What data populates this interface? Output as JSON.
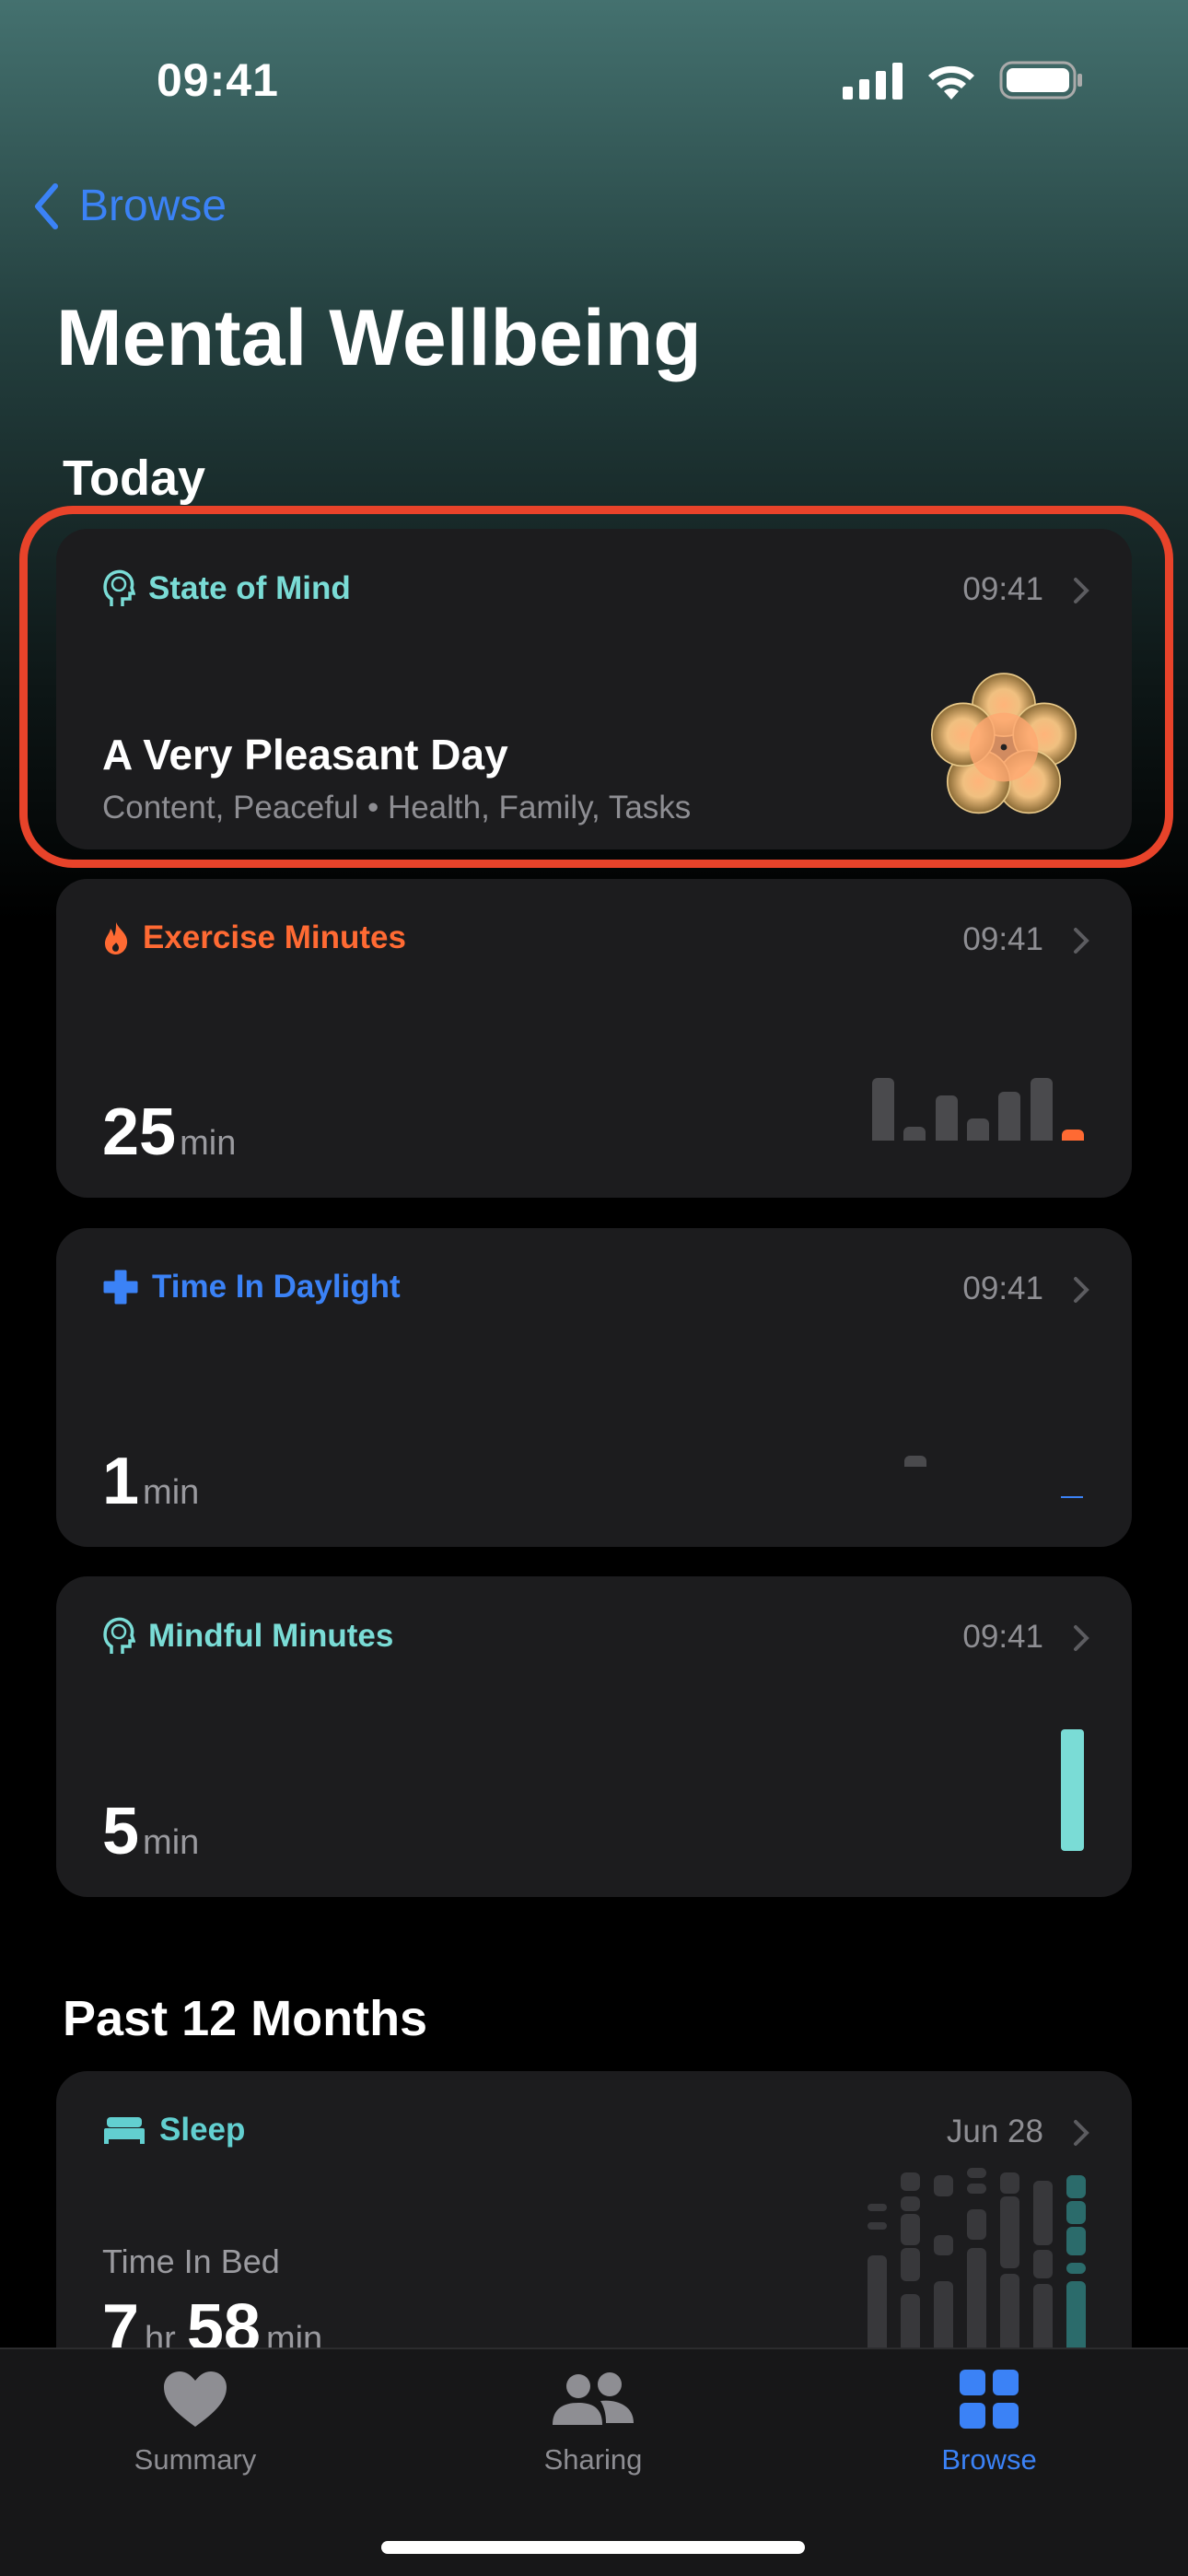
{
  "status_bar": {
    "time": "09:41",
    "icons": [
      "cellular-signal-icon",
      "wifi-icon",
      "battery-icon"
    ]
  },
  "nav": {
    "back_label": "Browse"
  },
  "page_title": "Mental Wellbeing",
  "sections": {
    "today": "Today",
    "past": "Past 12 Months"
  },
  "colors": {
    "state_of_mind": "#7adcd6",
    "exercise": "#ff6a33",
    "daylight": "#3b82f6",
    "mindful": "#7adcd6",
    "sleep": "#62cfd0",
    "highlight": "#e8432a"
  },
  "cards": {
    "state_of_mind": {
      "label": "State of Mind",
      "time": "09:41",
      "headline": "A Very Pleasant Day",
      "details": "Content, Peaceful • Health, Family, Tasks",
      "icon": "head-brain-icon"
    },
    "exercise": {
      "label": "Exercise Minutes",
      "time": "09:41",
      "value": "25",
      "unit": "min",
      "icon": "flame-icon",
      "bars": [
        140,
        30,
        100,
        50,
        110,
        140,
        25
      ]
    },
    "daylight": {
      "label": "Time In Daylight",
      "time": "09:41",
      "value": "1",
      "unit": "min",
      "icon": "plus-icon",
      "bars": [
        0,
        12,
        0,
        0,
        0,
        0,
        1
      ]
    },
    "mindful": {
      "label": "Mindful Minutes",
      "time": "09:41",
      "value": "5",
      "unit": "min",
      "icon": "head-brain-icon",
      "bars": [
        0,
        0,
        0,
        0,
        0,
        0,
        5
      ]
    },
    "sleep": {
      "label": "Sleep",
      "time": "Jun 28",
      "sublabel": "Time In Bed",
      "hours": "7",
      "hours_unit": "hr",
      "minutes": "58",
      "minutes_unit": "min",
      "icon": "bed-icon"
    }
  },
  "tabbar": {
    "items": [
      {
        "label": "Summary",
        "icon": "heart-icon"
      },
      {
        "label": "Sharing",
        "icon": "people-icon"
      },
      {
        "label": "Browse",
        "icon": "grid-icon",
        "selected": true
      }
    ]
  }
}
